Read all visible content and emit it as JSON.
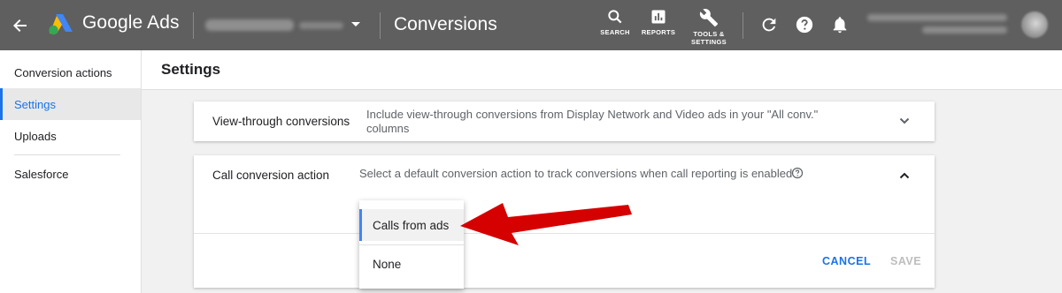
{
  "header": {
    "brand": "Google Ads",
    "page_title": "Conversions",
    "tools": [
      {
        "label": "SEARCH",
        "icon": "search-icon"
      },
      {
        "label": "REPORTS",
        "icon": "reports-icon"
      },
      {
        "label": "TOOLS &\nSETTINGS",
        "icon": "wrench-icon"
      }
    ]
  },
  "sidenav": {
    "items": [
      {
        "label": "Conversion actions"
      },
      {
        "label": "Settings"
      },
      {
        "label": "Uploads"
      },
      {
        "label": "Salesforce"
      }
    ]
  },
  "main": {
    "title": "Settings",
    "view_through": {
      "title": "View-through conversions",
      "description": "Include view-through conversions from Display Network and Video ads in your \"All conv.\" columns"
    },
    "call_conversion": {
      "title": "Call conversion action",
      "description": "Select a default conversion action to track conversions when call reporting is enabled",
      "options": [
        "Calls from ads",
        "None"
      ],
      "cancel_label": "CANCEL",
      "save_label": "SAVE"
    }
  },
  "colors": {
    "topbar": "#5f5f5f",
    "accent": "#1a73e8",
    "arrow": "#d50000"
  }
}
